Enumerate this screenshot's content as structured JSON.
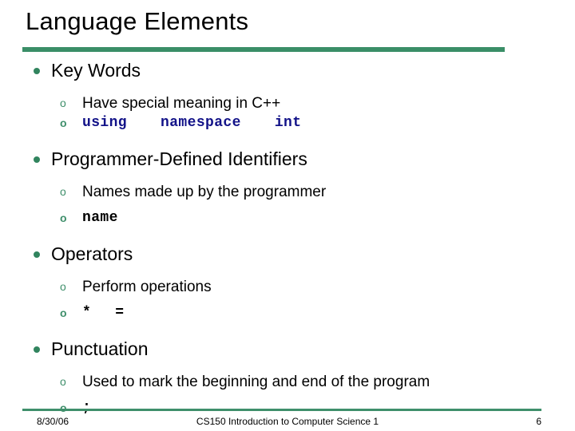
{
  "slide": {
    "title": "Language Elements",
    "accent_color": "#3a8e67",
    "code_color": "#121288",
    "text_color": "#000000",
    "sections": [
      {
        "heading": "Key Words",
        "items": [
          {
            "marker": "o",
            "text": "Have special meaning in C++",
            "style": "plain"
          },
          {
            "marker": "o",
            "tokens": [
              "using",
              "namespace",
              "int"
            ],
            "style": "code-blue"
          }
        ]
      },
      {
        "heading": "Programmer-Defined Identifiers",
        "items": [
          {
            "marker": "o",
            "text": "Names made up by the programmer",
            "style": "plain"
          },
          {
            "marker": "o",
            "tokens": [
              "name"
            ],
            "style": "code-black"
          }
        ]
      },
      {
        "heading": "Operators",
        "items": [
          {
            "marker": "o",
            "text": "Perform operations",
            "style": "plain"
          },
          {
            "marker": "o",
            "tokens": [
              "*",
              "="
            ],
            "style": "code-black"
          }
        ]
      },
      {
        "heading": "Punctuation",
        "items": [
          {
            "marker": "o",
            "text": "Used to mark the beginning and end of the program",
            "style": "plain"
          },
          {
            "marker": "o",
            "tokens": [
              ";"
            ],
            "style": "code-black"
          }
        ]
      }
    ]
  },
  "footer": {
    "date": "8/30/06",
    "center": "CS150 Introduction to Computer Science 1",
    "page": "6"
  }
}
